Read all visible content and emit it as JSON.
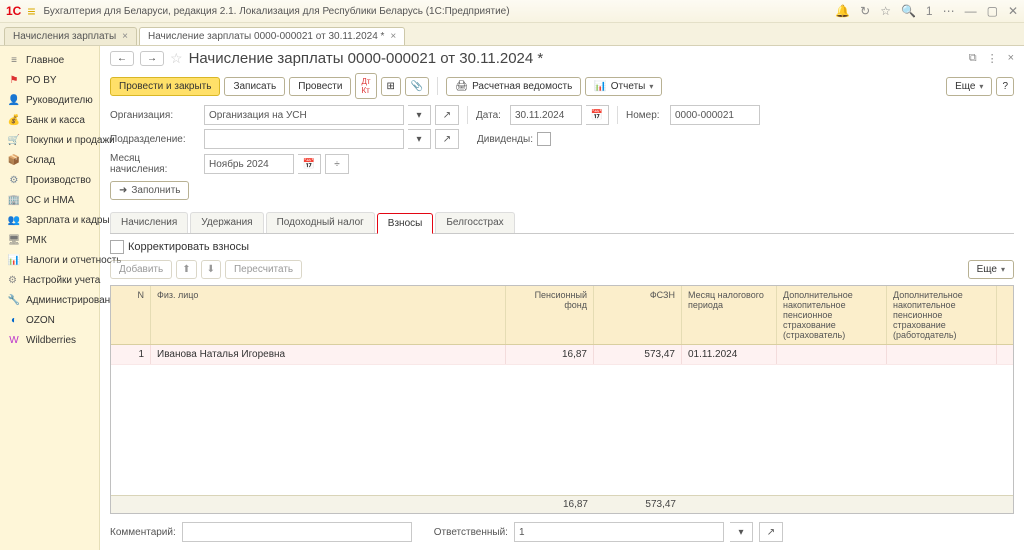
{
  "titlebar": {
    "app_title": "Бухгалтерия для Беларуси, редакция 2.1. Локализация для Республики Беларусь  (1С:Предприятие)"
  },
  "doc_tabs": [
    {
      "label": "Начисления зарплаты"
    },
    {
      "label": "Начисление зарплаты 0000-000021 от 30.11.2024 *"
    }
  ],
  "sidebar": {
    "items": [
      {
        "label": "Главное",
        "icon": "≡",
        "color": "#777"
      },
      {
        "label": "PO BY",
        "icon": "⚑",
        "color": "#d33"
      },
      {
        "label": "Руководителю",
        "icon": "👤",
        "color": "#4a7"
      },
      {
        "label": "Банк и касса",
        "icon": "💰",
        "color": "#3a8"
      },
      {
        "label": "Покупки и продажи",
        "icon": "🛒",
        "color": "#5aa"
      },
      {
        "label": "Склад",
        "icon": "📦",
        "color": "#c96"
      },
      {
        "label": "Производство",
        "icon": "⚙",
        "color": "#789"
      },
      {
        "label": "ОС и НМА",
        "icon": "🏢",
        "color": "#d77"
      },
      {
        "label": "Зарплата и кадры",
        "icon": "👥",
        "color": "#48c"
      },
      {
        "label": "РМК",
        "icon": "🖥",
        "color": "#777"
      },
      {
        "label": "Налоги и отчетность",
        "icon": "📊",
        "color": "#7a5"
      },
      {
        "label": "Настройки учета",
        "icon": "⚙",
        "color": "#888"
      },
      {
        "label": "Администрирование",
        "icon": "🔧",
        "color": "#888"
      },
      {
        "label": "OZON",
        "icon": "◐",
        "color": "#06c"
      },
      {
        "label": "Wildberries",
        "icon": "W",
        "color": "#b3c"
      }
    ]
  },
  "doc": {
    "title": "Начисление зарплаты 0000-000021 от 30.11.2024 *",
    "toolbar": {
      "post_close": "Провести и закрыть",
      "save": "Записать",
      "post": "Провести",
      "payroll_sheet": "Расчетная ведомость",
      "reports": "Отчеты",
      "more": "Еще"
    },
    "fields": {
      "org_label": "Организация:",
      "org_value": "Организация на УСН",
      "date_label": "Дата:",
      "date_value": "30.11.2024",
      "number_label": "Номер:",
      "number_value": "0000-000021",
      "dept_label": "Подразделение:",
      "dept_value": "",
      "dividends_label": "Дивиденды:",
      "month_label": "Месяц начисления:",
      "month_value": "Ноябрь 2024",
      "fill": "Заполнить"
    },
    "tabs": [
      "Начисления",
      "Удержания",
      "Подоходный налог",
      "Взносы",
      "Белгосстрах"
    ],
    "active_tab": 3,
    "sub": {
      "corr_label": "Корректировать взносы",
      "add": "Добавить",
      "recalc": "Пересчитать",
      "more": "Еще"
    },
    "table": {
      "headers": {
        "n": "N",
        "fio": "Физ. лицо",
        "pf": "Пенсионный фонд",
        "fszn": "ФСЗН",
        "period": "Месяц налогового периода",
        "dop1": "Дополнительное накопительное пенсионное страхование (страхователь)",
        "dop2": "Дополнительное накопительное пенсионное страхование (работодатель)"
      },
      "rows": [
        {
          "n": "1",
          "fio": "Иванова Наталья Игоревна",
          "pf": "16,87",
          "fszn": "573,47",
          "period": "01.11.2024",
          "dop1": "",
          "dop2": ""
        }
      ],
      "totals": {
        "pf": "16,87",
        "fszn": "573,47"
      }
    },
    "footer": {
      "comment_label": "Комментарий:",
      "comment_value": "",
      "resp_label": "Ответственный:",
      "resp_value": "1"
    }
  }
}
